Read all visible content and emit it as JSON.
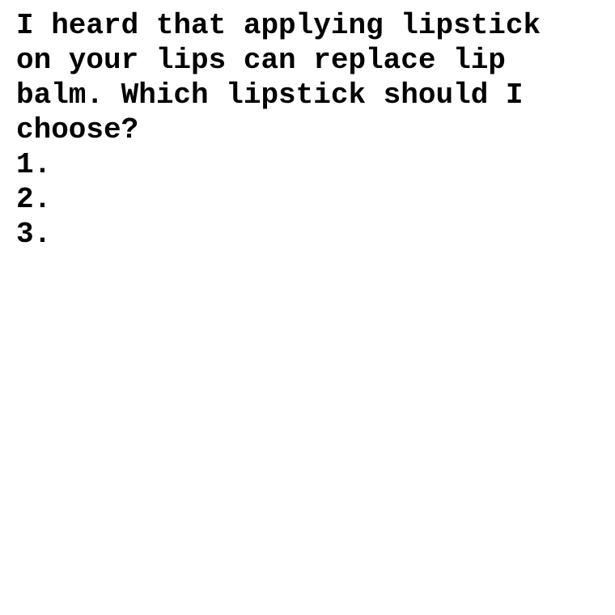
{
  "document": {
    "question_lines": [
      "I heard that applying lipstick",
      "on your lips can replace lip",
      "balm. Which lipstick should I",
      "choose?"
    ],
    "list_items": [
      "1.",
      "2.",
      "3."
    ]
  }
}
